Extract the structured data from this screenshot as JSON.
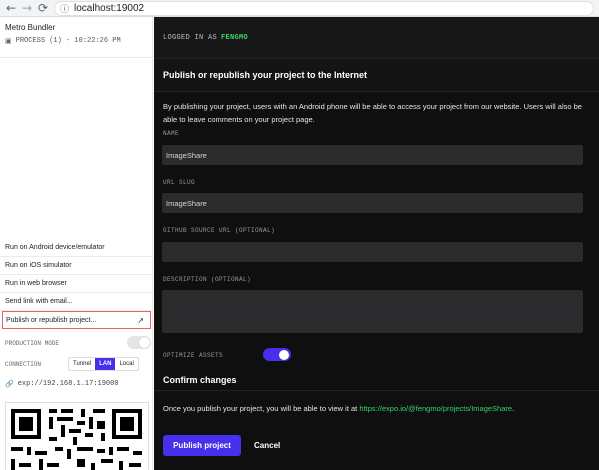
{
  "browser": {
    "back_icon": "arrow-left-icon",
    "forward_icon": "arrow-right-icon",
    "reload_icon": "reload-icon",
    "info_icon": "info-icon",
    "url": "localhost:19002"
  },
  "sidebar": {
    "title": "Metro Bundler",
    "process": "PROCESS (1) - 10:22:26 PM",
    "menu": [
      {
        "label": "Run on Android device/emulator"
      },
      {
        "label": "Run on iOS simulator"
      },
      {
        "label": "Run in web browser"
      },
      {
        "label": "Send link with email..."
      },
      {
        "label": "Publish or republish project..."
      }
    ],
    "production_mode_label": "PRODUCTION MODE",
    "production_mode_on": false,
    "connection_label": "CONNECTION",
    "connection_options": [
      "Tunnel",
      "LAN",
      "Local"
    ],
    "connection_selected": "LAN",
    "exp_url": "exp://192.168.1.17:19000"
  },
  "main": {
    "logged_in_prefix": "LOGGED IN AS",
    "username": "FENGMO",
    "section_title": "Publish or republish your project to the Internet",
    "intro": "By publishing your project, users with an Android phone will be able to access your project from our website. Users will also be able to leave comments on your project page.",
    "fields": {
      "name_label": "NAME",
      "name_value": "ImageShare",
      "slug_label": "URL SLUG",
      "slug_value": "ImageShare",
      "github_label": "GITHUB SOURCE URL (OPTIONAL)",
      "github_value": "",
      "description_label": "DESCRIPTION (OPTIONAL)",
      "description_value": ""
    },
    "optimize_label": "OPTIMIZE ASSETS",
    "optimize_on": true,
    "confirm_title": "Confirm changes",
    "confirm_prefix": "Once you publish your project, you will be able to view it at",
    "confirm_link": "https://expo.io/@fengmo/projects/ImageShare",
    "confirm_suffix": ".",
    "publish_label": "Publish project",
    "cancel_label": "Cancel"
  },
  "colors": {
    "accent": "#4630eb",
    "link_green": "#35d46a",
    "dark_bg": "#0f0f10",
    "input_bg": "#2b2b2d"
  }
}
